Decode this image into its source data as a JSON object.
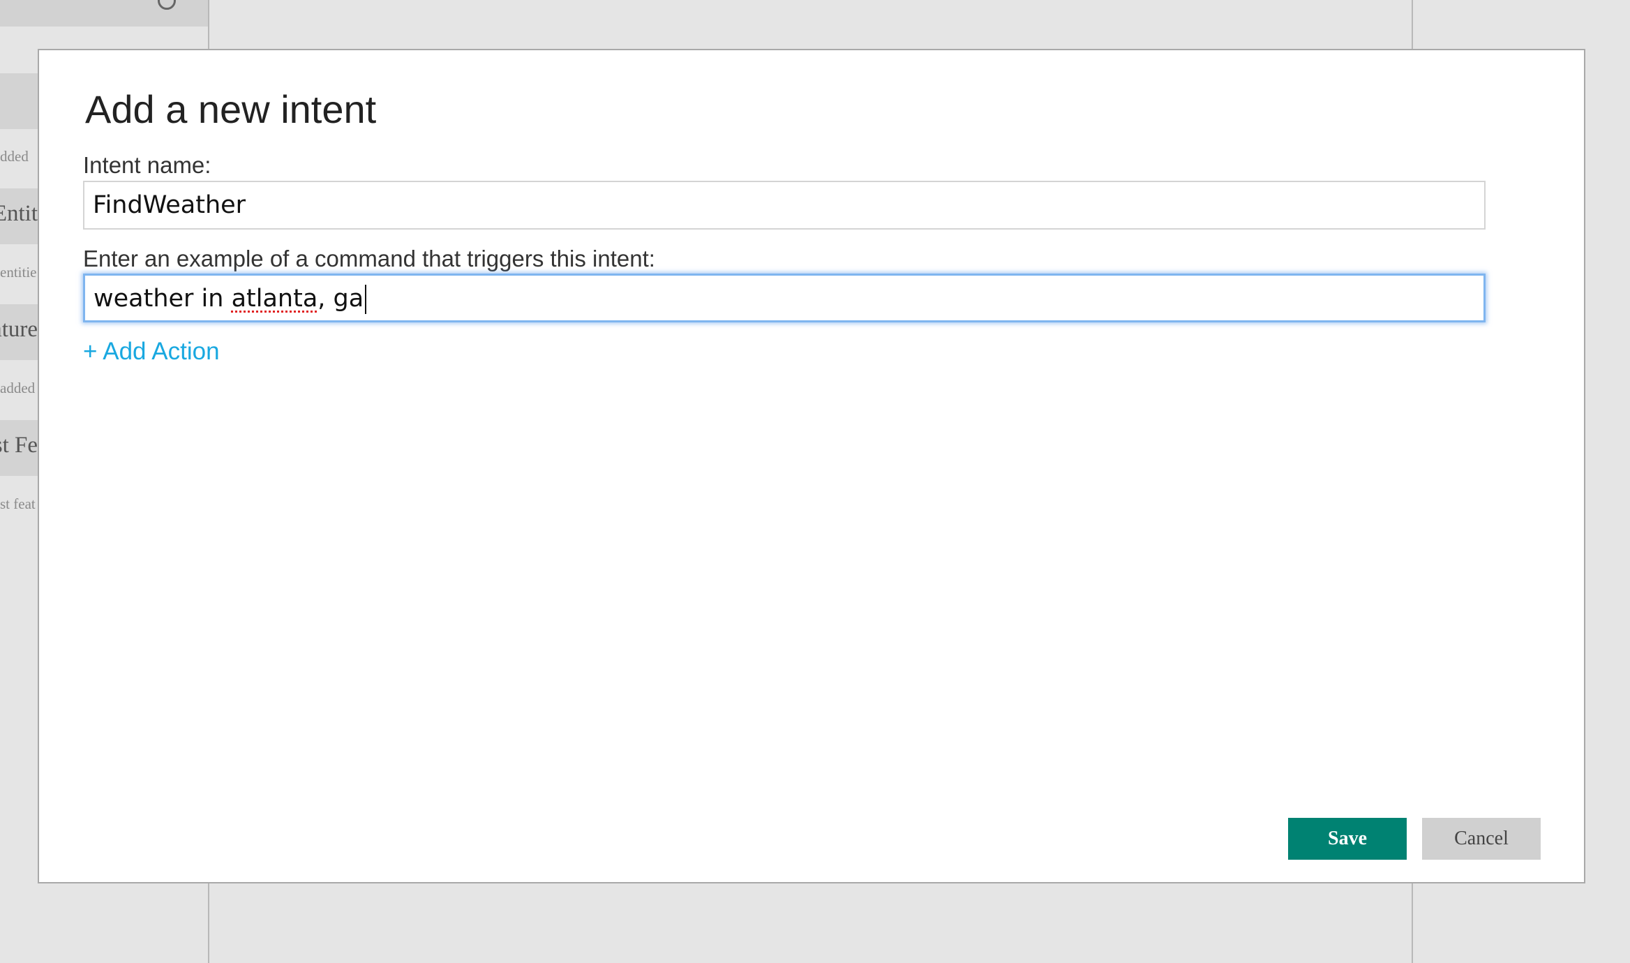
{
  "background": {
    "sidebar_fragments": [
      "dded",
      "Entit",
      "entitie",
      "ature",
      "added",
      "st Fe",
      "st feat"
    ]
  },
  "dialog": {
    "title": "Add a new intent",
    "intent_name_label": "Intent name:",
    "intent_name_value": "FindWeather",
    "example_label": "Enter an example of a command that triggers this intent:",
    "example_value_part1": "weather in ",
    "example_value_misspelled": "atlanta",
    "example_value_part2": ", ga",
    "add_action_label": "+ Add Action",
    "save_label": "Save",
    "cancel_label": "Cancel"
  },
  "colors": {
    "save_button": "#008272",
    "cancel_button": "#d0d0d0",
    "link": "#19a8e0",
    "focus_ring": "#7fb5ef"
  }
}
